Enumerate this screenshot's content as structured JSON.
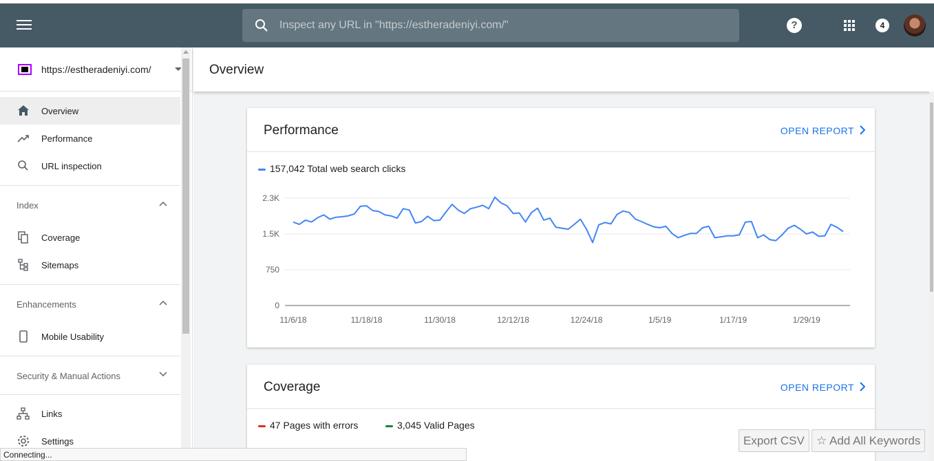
{
  "search": {
    "placeholder": "Inspect any URL in \"https://estheradeniyi.com/\""
  },
  "topbar": {
    "help": "?",
    "notifications": "4"
  },
  "property": {
    "url": "https://estheradeniyi.com/"
  },
  "nav": {
    "overview": "Overview",
    "performance": "Performance",
    "url_inspection": "URL inspection",
    "index_section": "Index",
    "coverage": "Coverage",
    "sitemaps": "Sitemaps",
    "enhancements_section": "Enhancements",
    "mobile_usability": "Mobile Usability",
    "security_section": "Security & Manual Actions",
    "links": "Links",
    "settings": "Settings"
  },
  "page": {
    "title": "Overview"
  },
  "performance_card": {
    "title": "Performance",
    "open_report": "OPEN REPORT",
    "legend": "157,042 Total web search clicks",
    "legend_color": "#4285f4"
  },
  "coverage_card": {
    "title": "Coverage",
    "open_report": "OPEN REPORT",
    "errors": "47 Pages with errors",
    "errors_color": "#d93025",
    "valid": "3,045 Valid Pages",
    "valid_color": "#188038"
  },
  "status_bar": "Connecting...",
  "extension": {
    "export_csv": "Export CSV",
    "add_keywords": "Add All Keywords"
  },
  "chart_data": {
    "type": "line",
    "series": [
      {
        "values": [
          1750,
          1700,
          1790,
          1750,
          1840,
          1900,
          1810,
          1850,
          1860,
          1880,
          1920,
          2080,
          2090,
          1990,
          1970,
          1900,
          1880,
          1830,
          2030,
          2000,
          1730,
          1760,
          1870,
          1780,
          1790,
          1960,
          2120,
          2000,
          1930,
          2030,
          2060,
          2100,
          2030,
          2270,
          2150,
          2090,
          1930,
          1940,
          1750,
          1950,
          2040,
          1790,
          1830,
          1640,
          1620,
          1600,
          1700,
          1810,
          1600,
          1320,
          1690,
          1740,
          1710,
          1910,
          1980,
          1950,
          1810,
          1760,
          1700,
          1650,
          1630,
          1660,
          1510,
          1420,
          1470,
          1510,
          1510,
          1630,
          1660,
          1420,
          1440,
          1460,
          1460,
          1480,
          1750,
          1760,
          1420,
          1480,
          1380,
          1360,
          1480,
          1620,
          1680,
          1600,
          1500,
          1540,
          1450,
          1460,
          1700,
          1640,
          1550
        ],
        "color": "#4285f4"
      }
    ],
    "x_tick_labels": [
      "11/6/18",
      "11/18/18",
      "11/30/18",
      "12/12/18",
      "12/24/18",
      "1/5/19",
      "1/17/19",
      "1/29/19"
    ],
    "y_tick_labels": [
      "0",
      "750",
      "1.5K",
      "2.3K"
    ],
    "ylim": [
      0,
      2250
    ],
    "grid": true
  }
}
